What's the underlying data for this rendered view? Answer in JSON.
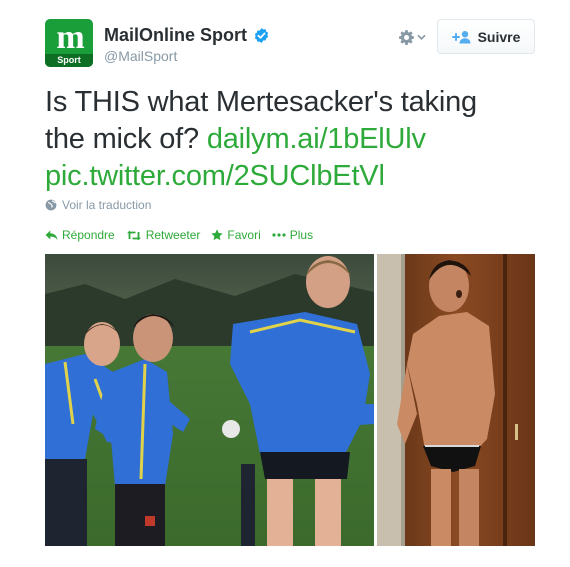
{
  "account": {
    "display_name": "MailOnline Sport",
    "handle": "@MailSport",
    "avatar_text": "m",
    "avatar_sub": "Sport",
    "verified": true
  },
  "header": {
    "follow_label": "Suivre"
  },
  "tweet": {
    "line1": "Is THIS what Mertesacker's taking",
    "line2_text": "the mick of? ",
    "link_url": "dailym.ai/1bElUlv",
    "pic_link": "pic.twitter.com/2SUClbEtVl"
  },
  "translate": {
    "label": "Voir la traduction"
  },
  "actions": [
    {
      "label": "Répondre",
      "icon": "reply-icon"
    },
    {
      "label": "Retweeter",
      "icon": "retweet-icon"
    },
    {
      "label": "Favori",
      "icon": "star-icon"
    },
    {
      "label": "Plus",
      "icon": "more-dots-icon"
    }
  ],
  "colors": {
    "link": "#2eaa3a",
    "brand": "#1a9e3a",
    "verified": "#1da1f2",
    "muted": "#8899a6"
  }
}
